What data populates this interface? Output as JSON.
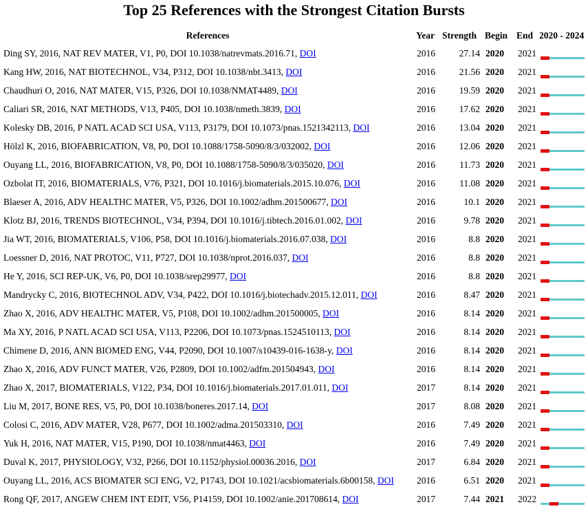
{
  "title": "Top 25 References with the Strongest Citation Bursts",
  "headers": {
    "references": "References",
    "year": "Year",
    "strength": "Strength",
    "begin": "Begin",
    "end": "End",
    "range": "2020 - 2024"
  },
  "timeline": {
    "start": 2020,
    "end": 2024
  },
  "colors": {
    "burst": "#e31010",
    "base": "#5fc9c9",
    "link": "#0000ee"
  },
  "rows": [
    {
      "ref": "Ding SY, 2016, NAT REV MATER, V1, P0, DOI 10.1038/natrevmats.2016.71,",
      "doi": "DOI",
      "year": "2016",
      "strength": "27.14",
      "begin": "2020",
      "end": "2021"
    },
    {
      "ref": "Kang HW, 2016, NAT BIOTECHNOL, V34, P312, DOI 10.1038/nbt.3413,",
      "doi": "DOI",
      "year": "2016",
      "strength": "21.56",
      "begin": "2020",
      "end": "2021"
    },
    {
      "ref": "Chaudhuri O, 2016, NAT MATER, V15, P326, DOI 10.1038/NMAT4489,",
      "doi": "DOI",
      "year": "2016",
      "strength": "19.59",
      "begin": "2020",
      "end": "2021"
    },
    {
      "ref": "Caliari SR, 2016, NAT METHODS, V13, P405, DOI 10.1038/nmeth.3839,",
      "doi": "DOI",
      "year": "2016",
      "strength": "17.62",
      "begin": "2020",
      "end": "2021"
    },
    {
      "ref": "Kolesky DB, 2016, P NATL ACAD SCI USA, V113, P3179, DOI 10.1073/pnas.1521342113,",
      "doi": "DOI",
      "year": "2016",
      "strength": "13.04",
      "begin": "2020",
      "end": "2021"
    },
    {
      "ref": "Hölzl K, 2016, BIOFABRICATION, V8, P0, DOI 10.1088/1758-5090/8/3/032002,",
      "doi": "DOI",
      "year": "2016",
      "strength": "12.06",
      "begin": "2020",
      "end": "2021"
    },
    {
      "ref": "Ouyang LL, 2016, BIOFABRICATION, V8, P0, DOI 10.1088/1758-5090/8/3/035020,",
      "doi": "DOI",
      "year": "2016",
      "strength": "11.73",
      "begin": "2020",
      "end": "2021"
    },
    {
      "ref": "Ozbolat IT, 2016, BIOMATERIALS, V76, P321, DOI 10.1016/j.biomaterials.2015.10.076,",
      "doi": "DOI",
      "year": "2016",
      "strength": "11.08",
      "begin": "2020",
      "end": "2021"
    },
    {
      "ref": "Blaeser A, 2016, ADV HEALTHC MATER, V5, P326, DOI 10.1002/adhm.201500677,",
      "doi": "DOI",
      "year": "2016",
      "strength": "10.1",
      "begin": "2020",
      "end": "2021"
    },
    {
      "ref": "Klotz BJ, 2016, TRENDS BIOTECHNOL, V34, P394, DOI 10.1016/j.tibtech.2016.01.002,",
      "doi": "DOI",
      "year": "2016",
      "strength": "9.78",
      "begin": "2020",
      "end": "2021"
    },
    {
      "ref": "Jia WT, 2016, BIOMATERIALS, V106, P58, DOI 10.1016/j.biomaterials.2016.07.038,",
      "doi": "DOI",
      "year": "2016",
      "strength": "8.8",
      "begin": "2020",
      "end": "2021"
    },
    {
      "ref": "Loessner D, 2016, NAT PROTOC, V11, P727, DOI 10.1038/nprot.2016.037,",
      "doi": "DOI",
      "year": "2016",
      "strength": "8.8",
      "begin": "2020",
      "end": "2021"
    },
    {
      "ref": "He Y, 2016, SCI REP-UK, V6, P0, DOI 10.1038/srep29977,",
      "doi": "DOI",
      "year": "2016",
      "strength": "8.8",
      "begin": "2020",
      "end": "2021"
    },
    {
      "ref": "Mandrycky C, 2016, BIOTECHNOL ADV, V34, P422, DOI 10.1016/j.biotechadv.2015.12.011,",
      "doi": "DOI",
      "year": "2016",
      "strength": "8.47",
      "begin": "2020",
      "end": "2021"
    },
    {
      "ref": "Zhao X, 2016, ADV HEALTHC MATER, V5, P108, DOI 10.1002/adhm.201500005,",
      "doi": "DOI",
      "year": "2016",
      "strength": "8.14",
      "begin": "2020",
      "end": "2021"
    },
    {
      "ref": "Ma XY, 2016, P NATL ACAD SCI USA, V113, P2206, DOI 10.1073/pnas.1524510113,",
      "doi": "DOI",
      "year": "2016",
      "strength": "8.14",
      "begin": "2020",
      "end": "2021"
    },
    {
      "ref": "Chimene D, 2016, ANN BIOMED ENG, V44, P2090, DOI 10.1007/s10439-016-1638-y,",
      "doi": "DOI",
      "year": "2016",
      "strength": "8.14",
      "begin": "2020",
      "end": "2021"
    },
    {
      "ref": "Zhao X, 2016, ADV FUNCT MATER, V26, P2809, DOI 10.1002/adfm.201504943,",
      "doi": "DOI",
      "year": "2016",
      "strength": "8.14",
      "begin": "2020",
      "end": "2021"
    },
    {
      "ref": "Zhao X, 2017, BIOMATERIALS, V122, P34, DOI 10.1016/j.biomaterials.2017.01.011,",
      "doi": "DOI",
      "year": "2017",
      "strength": "8.14",
      "begin": "2020",
      "end": "2021"
    },
    {
      "ref": "Liu M, 2017, BONE RES, V5, P0, DOI 10.1038/boneres.2017.14,",
      "doi": "DOI",
      "year": "2017",
      "strength": "8.08",
      "begin": "2020",
      "end": "2021"
    },
    {
      "ref": "Colosi C, 2016, ADV MATER, V28, P677, DOI 10.1002/adma.201503310,",
      "doi": "DOI",
      "year": "2016",
      "strength": "7.49",
      "begin": "2020",
      "end": "2021"
    },
    {
      "ref": "Yuk H, 2016, NAT MATER, V15, P190, DOI 10.1038/nmat4463,",
      "doi": "DOI",
      "year": "2016",
      "strength": "7.49",
      "begin": "2020",
      "end": "2021"
    },
    {
      "ref": "Duval K, 2017, PHYSIOLOGY, V32, P266, DOI 10.1152/physiol.00036.2016,",
      "doi": "DOI",
      "year": "2017",
      "strength": "6.84",
      "begin": "2020",
      "end": "2021"
    },
    {
      "ref": "Ouyang LL, 2016, ACS BIOMATER SCI ENG, V2, P1743, DOI 10.1021/acsbiomaterials.6b00158,",
      "doi": "DOI",
      "year": "2016",
      "strength": "6.51",
      "begin": "2020",
      "end": "2021"
    },
    {
      "ref": "Rong QF, 2017, ANGEW CHEM INT EDIT, V56, P14159, DOI 10.1002/anie.201708614,",
      "doi": "DOI",
      "year": "2017",
      "strength": "7.44",
      "begin": "2021",
      "end": "2022"
    }
  ]
}
